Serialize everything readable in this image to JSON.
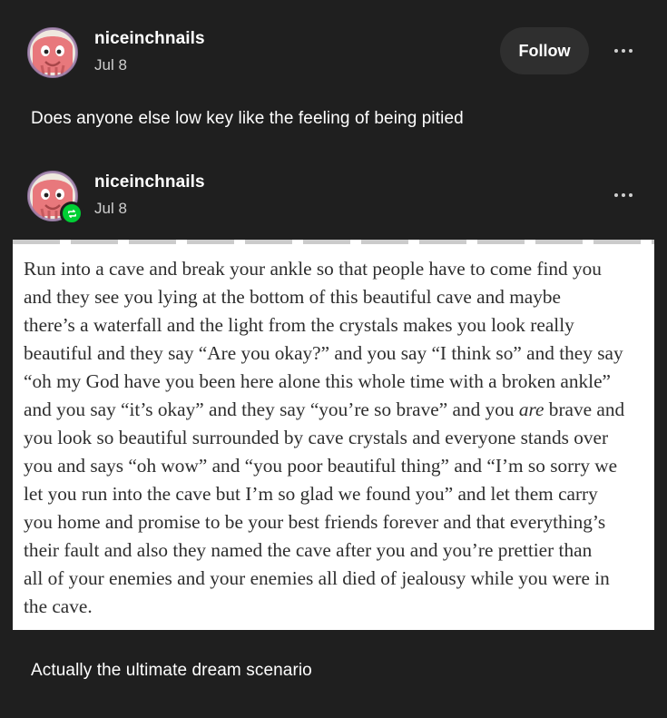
{
  "original_post": {
    "username": "niceinchnails",
    "date": "Jul 8",
    "follow_label": "Follow",
    "text": "Does anyone else low key like the feeling of being pitied"
  },
  "reblog": {
    "username": "niceinchnails",
    "date": "Jul 8",
    "badge_icon": "reblog-icon",
    "badge_color": "#00cf35",
    "quote_lines": [
      "Run into a cave and break your ankle so that people have to come find you",
      "and they see you lying at the bottom of this beautiful cave and maybe",
      "there’s a waterfall and the light from the crystals makes you look really",
      "beautiful and they say “Are you okay?” and you say “I think so” and they say",
      "“oh my God have you been here alone this whole time with a broken ankle”",
      "and you say “it’s okay” and they say “you’re so brave” and you ",
      "you look so beautiful surrounded by cave crystals and everyone stands over",
      "you and says “oh wow” and “you poor beautiful thing” and “I’m so sorry we",
      "let you run into the cave but I’m so glad we found you” and let them carry",
      "you home and promise to be your best friends forever and that everything’s",
      "their fault and also they named the cave after you and you’re prettier than",
      "all of your enemies and your enemies all died of jealousy while you were in",
      "the cave."
    ],
    "quote_emphasis": "are",
    "quote_line6_tail": " brave and",
    "caption": "Actually the ultimate dream scenario"
  },
  "colors": {
    "background": "#1f1f1f",
    "follow_button_bg": "#2f2f2f",
    "avatar_pink": "#e8787c"
  }
}
